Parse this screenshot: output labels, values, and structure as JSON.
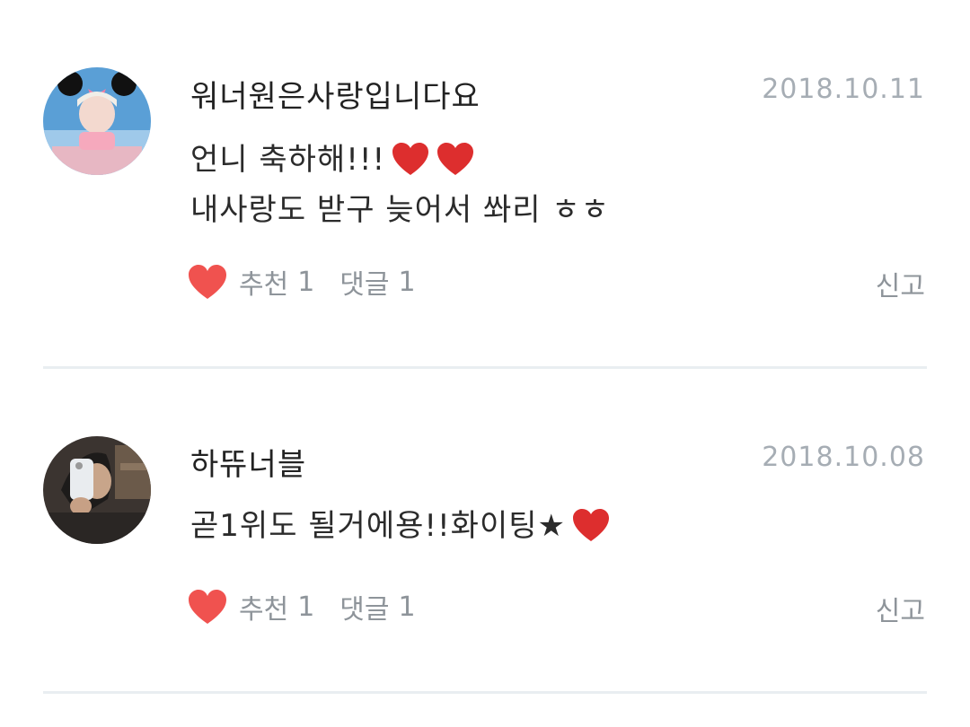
{
  "comments": [
    {
      "author": "워너원은사랑입니다요",
      "date": "2018.10.11",
      "text_lines": [
        "언니 축하해!!!",
        "내사랑도 받구 늦어서 쏴리 ㅎㅎ"
      ],
      "line1_emoji": [
        "red-heart",
        "red-heart"
      ],
      "like_label": "추천",
      "like_count": "1",
      "reply_label": "댓글",
      "reply_count": "1",
      "report_label": "신고",
      "avatar_icon": "user-avatar-photo"
    },
    {
      "author": "하뜌너블",
      "date": "2018.10.08",
      "text_lines": [
        "곧1위도 될거에용!!화이팅★"
      ],
      "line1_emoji": [
        "red-heart"
      ],
      "like_label": "추천",
      "like_count": "1",
      "reply_label": "댓글",
      "reply_count": "1",
      "report_label": "신고",
      "avatar_icon": "user-avatar-photo"
    }
  ],
  "colors": {
    "heart": "#f0524f",
    "emoji_heart": "#dd2e2e",
    "date": "#a6adb4",
    "meta": "#8e949a",
    "divider": "#e9eef1"
  }
}
